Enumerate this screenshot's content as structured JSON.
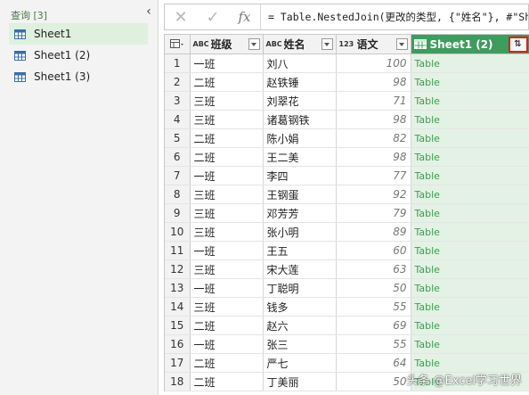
{
  "queries": {
    "header": "查询 [3]",
    "collapse_glyph": "‹",
    "items": [
      "Sheet1",
      "Sheet1 (2)",
      "Sheet1 (3)"
    ]
  },
  "formula_bar": {
    "cancel_glyph": "✕",
    "confirm_glyph": "✓",
    "fx_label": "fx",
    "formula": "= Table.NestedJoin(更改的类型, {\"姓名\"}, #\"Sh"
  },
  "grid": {
    "columns": [
      {
        "type": "ABC",
        "name": "班级"
      },
      {
        "type": "ABC",
        "name": "姓名"
      },
      {
        "type": "123",
        "name": "语文"
      },
      {
        "name": "Sheet1 (2)",
        "expand_glyph": "⇅"
      }
    ],
    "rows": [
      {
        "n": "1",
        "class": "一班",
        "name": "刘八",
        "score": "100",
        "t": "Table"
      },
      {
        "n": "2",
        "class": "二班",
        "name": "赵铁锤",
        "score": "98",
        "t": "Table"
      },
      {
        "n": "3",
        "class": "三班",
        "name": "刘翠花",
        "score": "71",
        "t": "Table"
      },
      {
        "n": "4",
        "class": "三班",
        "name": "诸葛钢铁",
        "score": "98",
        "t": "Table"
      },
      {
        "n": "5",
        "class": "二班",
        "name": "陈小娟",
        "score": "82",
        "t": "Table"
      },
      {
        "n": "6",
        "class": "二班",
        "name": "王二美",
        "score": "98",
        "t": "Table"
      },
      {
        "n": "7",
        "class": "一班",
        "name": "李四",
        "score": "77",
        "t": "Table"
      },
      {
        "n": "8",
        "class": "三班",
        "name": "王钢蛋",
        "score": "92",
        "t": "Table"
      },
      {
        "n": "9",
        "class": "三班",
        "name": "邓芳芳",
        "score": "79",
        "t": "Table"
      },
      {
        "n": "10",
        "class": "三班",
        "name": "张小明",
        "score": "89",
        "t": "Table"
      },
      {
        "n": "11",
        "class": "一班",
        "name": "王五",
        "score": "60",
        "t": "Table"
      },
      {
        "n": "12",
        "class": "三班",
        "name": "宋大莲",
        "score": "63",
        "t": "Table"
      },
      {
        "n": "13",
        "class": "一班",
        "name": "丁聪明",
        "score": "50",
        "t": "Table"
      },
      {
        "n": "14",
        "class": "三班",
        "name": "钱多",
        "score": "55",
        "t": "Table"
      },
      {
        "n": "15",
        "class": "二班",
        "name": "赵六",
        "score": "69",
        "t": "Table"
      },
      {
        "n": "16",
        "class": "一班",
        "name": "张三",
        "score": "55",
        "t": "Table"
      },
      {
        "n": "17",
        "class": "二班",
        "name": "严七",
        "score": "64",
        "t": "Table"
      },
      {
        "n": "18",
        "class": "二班",
        "name": "丁美丽",
        "score": "50",
        "t": "Table"
      }
    ]
  },
  "watermark": "头条 @Excel学习世界",
  "colors": {
    "accent": "#3f9b5e",
    "table_cell": "#e3f2e5",
    "highlight_box": "#e0201e"
  }
}
